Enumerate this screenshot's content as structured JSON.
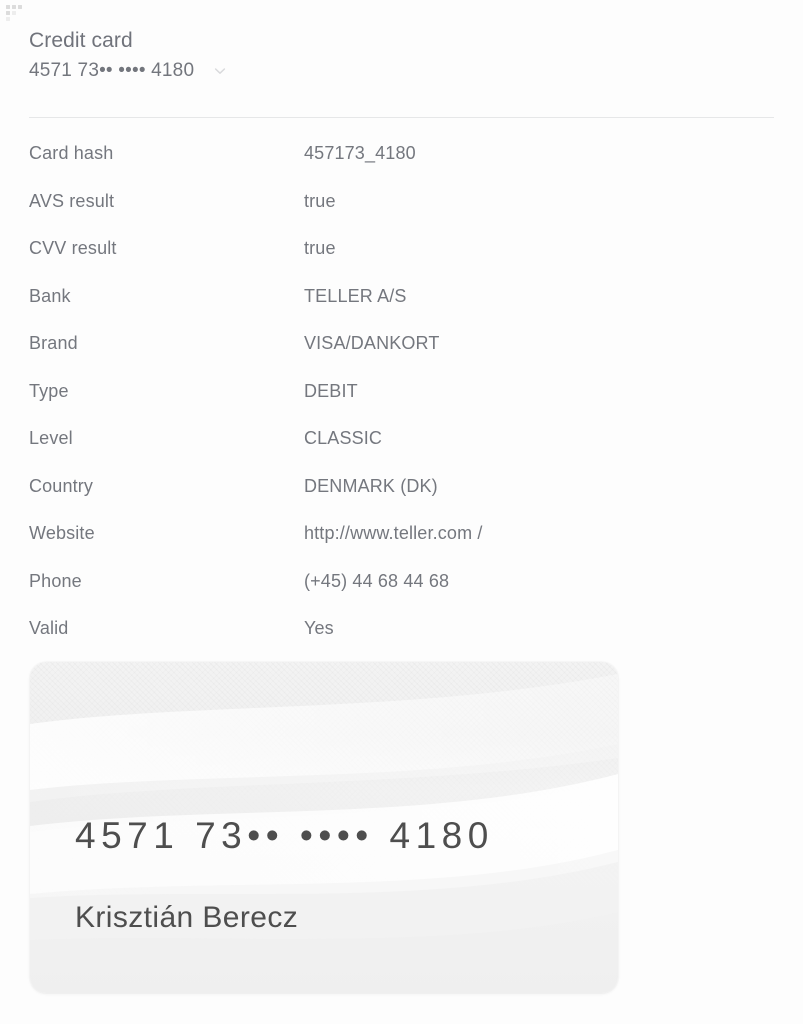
{
  "window": {
    "background_color": "#fdfdfd",
    "drag_handle_icon": "drag-dots-icon"
  },
  "header": {
    "title": "Credit card",
    "masked_number": "4571 73•• •••• 4180",
    "expand_icon": "chevron-down-icon"
  },
  "details": {
    "rows": [
      {
        "label": "Card hash",
        "value": "457173_4180"
      },
      {
        "label": "AVS result",
        "value": "true"
      },
      {
        "label": "CVV result",
        "value": "true"
      },
      {
        "label": "Bank",
        "value": "TELLER A/S"
      },
      {
        "label": "Brand",
        "value": "VISA/DANKORT"
      },
      {
        "label": "Type",
        "value": "DEBIT"
      },
      {
        "label": "Level",
        "value": "CLASSIC"
      },
      {
        "label": "Country",
        "value": "DENMARK (DK)"
      },
      {
        "label": "Website",
        "value": "http://www.teller.com /"
      },
      {
        "label": "Phone",
        "value": "(+45) 44 68 44 68"
      },
      {
        "label": "Valid",
        "value": "Yes"
      }
    ]
  },
  "card_graphic": {
    "number": "4571 73•• •••• 4180",
    "holder_name": "Krisztián Berecz",
    "face_color": "#f2f2f2",
    "text_color": "#4e4e4e"
  },
  "colors": {
    "text_primary": "#70737b",
    "text_secondary": "#74777e",
    "divider": "#e6e7e8",
    "background": "#fdfdfd"
  }
}
